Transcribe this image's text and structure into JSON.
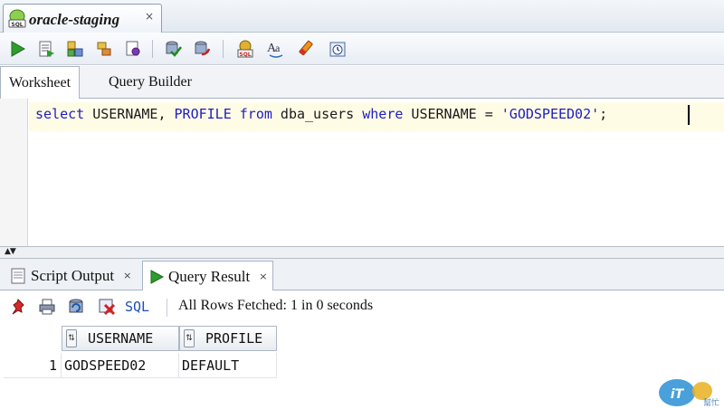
{
  "document_tab": {
    "title": "oracle-staging",
    "close": "×",
    "icon": "sql-worksheet-icon"
  },
  "toolbar": {
    "buttons": [
      "run-statement-icon",
      "run-script-icon",
      "autotrace-icon",
      "explain-plan-icon",
      "sql-tuning-icon",
      "commit-icon",
      "rollback-icon",
      "unshared-sql-worksheet-icon",
      "to-upper-lower-icon",
      "clear-eraser-icon",
      "sql-history-icon"
    ]
  },
  "subtabs": {
    "worksheet": "Worksheet",
    "query_builder": "Query Builder"
  },
  "editor": {
    "kw_select": "select",
    "t1": " USERNAME, ",
    "kw_profile": "PROFILE",
    "t2": " ",
    "kw_from": "from",
    "t3": " dba_users ",
    "kw_where": "where",
    "t4": " USERNAME = ",
    "str": "'GODSPEED02'",
    "t5": ";"
  },
  "splitter": {
    "arrows": "▲▼"
  },
  "result_tabs": {
    "script_output": "Script Output",
    "query_result": "Query Result",
    "close": "×"
  },
  "result_toolbar": {
    "sql_label": "SQL",
    "status": "All Rows Fetched: 1 in 0 seconds",
    "icons": [
      "pin-icon",
      "print-icon",
      "refresh-icon",
      "delete-icon"
    ]
  },
  "grid": {
    "columns": [
      "USERNAME",
      "PROFILE"
    ],
    "sort_glyph": "⇅",
    "rows": [
      {
        "num": "1",
        "username": "GODSPEED02",
        "profile": "DEFAULT"
      }
    ]
  },
  "watermark": {
    "text": "iT邦幫忙"
  },
  "colors": {
    "keyword": "#1d1dbf",
    "link": "#1d4fb6",
    "current_line": "#fffce6"
  }
}
